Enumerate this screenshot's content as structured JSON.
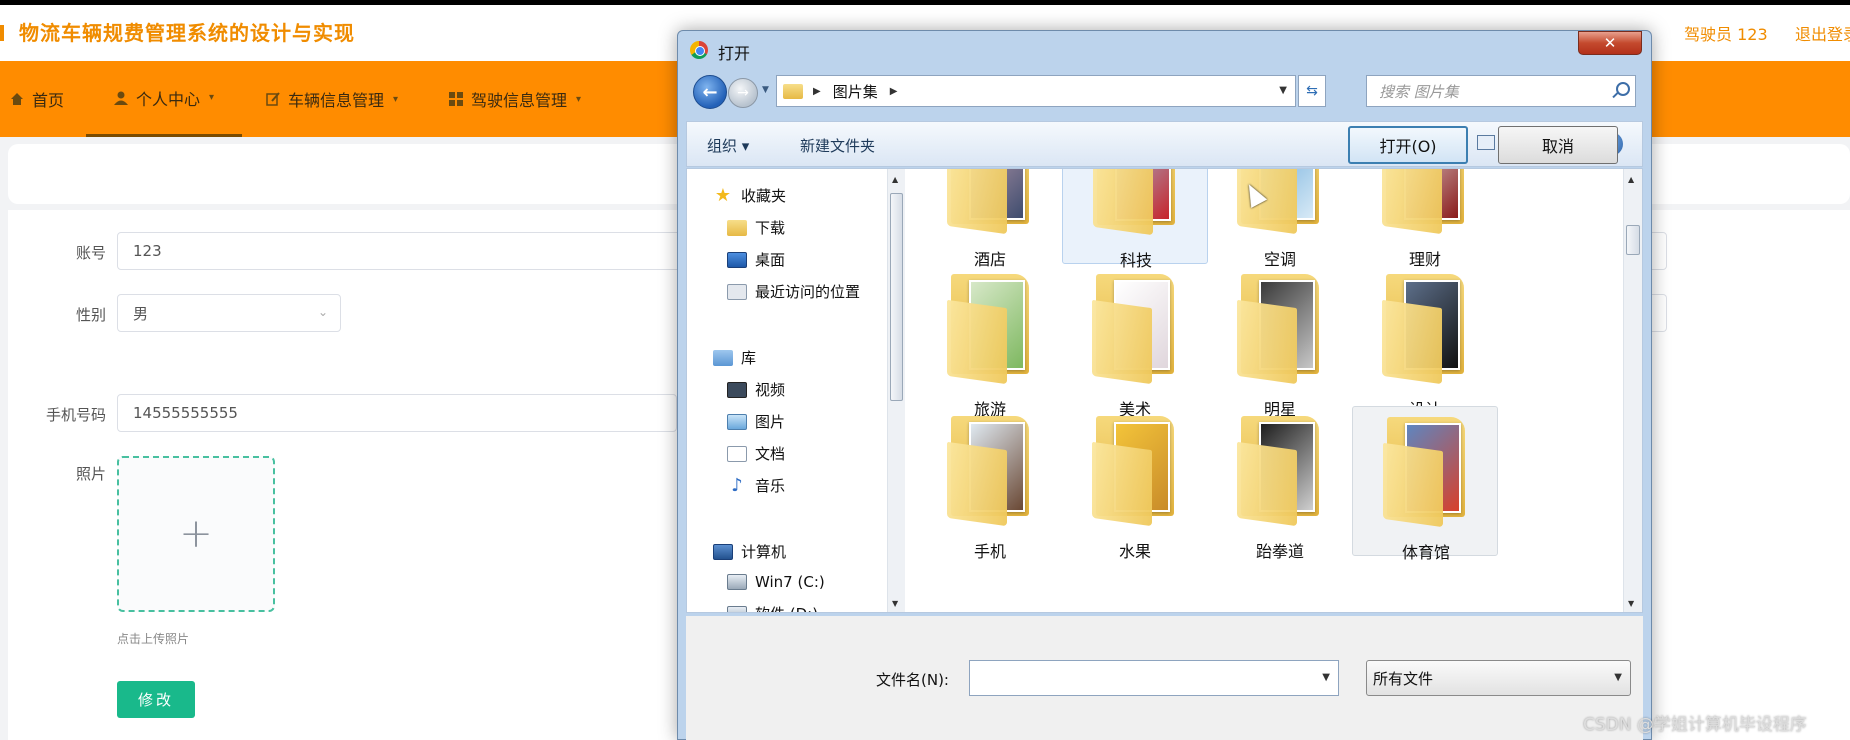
{
  "app": {
    "title": "物流车辆规费管理系统的设计与实现",
    "user_label": "驾驶员 123",
    "logout_label": "退出登录",
    "accent_color": "#ff8c00"
  },
  "nav": {
    "items": [
      {
        "label": "首页",
        "icon": "home-icon"
      },
      {
        "label": "个人中心",
        "icon": "user-icon"
      },
      {
        "label": "车辆信息管理",
        "icon": "edit-icon"
      },
      {
        "label": "驾驶信息管理",
        "icon": "grid-icon"
      }
    ],
    "active_index": 1
  },
  "form": {
    "account_label": "账号",
    "account_value": "123",
    "gender_label": "性别",
    "gender_value": "男",
    "phone_label": "手机号码",
    "phone_value": "14555555555",
    "photo_label": "照片",
    "upload_plus": "+",
    "upload_hint": "点击上传照片",
    "submit_label": "修改"
  },
  "dialog": {
    "title": "打开",
    "close_label": "✕",
    "path": "图片集",
    "search_placeholder": "搜索 图片集",
    "toolbar": {
      "organize_label": "组织 ▾",
      "new_folder_label": "新建文件夹"
    },
    "tree": [
      {
        "label": "收藏夹",
        "icon": "star-icon"
      },
      {
        "label": "下载",
        "icon": "download-folder-icon"
      },
      {
        "label": "桌面",
        "icon": "desktop-icon"
      },
      {
        "label": "最近访问的位置",
        "icon": "recent-places-icon"
      },
      {
        "label": "库",
        "icon": "library-icon"
      },
      {
        "label": "视频",
        "icon": "video-icon"
      },
      {
        "label": "图片",
        "icon": "pictures-icon"
      },
      {
        "label": "文档",
        "icon": "documents-icon"
      },
      {
        "label": "音乐",
        "icon": "music-icon"
      },
      {
        "label": "计算机",
        "icon": "computer-icon"
      },
      {
        "label": "Win7 (C:)",
        "icon": "drive-icon"
      },
      {
        "label": "软件 (D:)",
        "icon": "drive-icon"
      }
    ],
    "folders": [
      {
        "label": "酒店",
        "colors": [
          "#c7a4b4",
          "#3e4c6e"
        ]
      },
      {
        "label": "科技",
        "colors": [
          "#9cc6e6",
          "#c7242a"
        ]
      },
      {
        "label": "空调",
        "colors": [
          "#5ea3d8",
          "#d8eaf6"
        ]
      },
      {
        "label": "理财",
        "colors": [
          "#e3e3e3",
          "#8a1a1a"
        ]
      },
      {
        "label": "旅游",
        "colors": [
          "#d7e8c8",
          "#7eb860"
        ]
      },
      {
        "label": "美术",
        "colors": [
          "#ffffff",
          "#e0d6dc"
        ]
      },
      {
        "label": "明星",
        "colors": [
          "#3a3a3a",
          "#c7c7c7"
        ]
      },
      {
        "label": "设计",
        "colors": [
          "#5d6f8a",
          "#111111"
        ]
      },
      {
        "label": "手机",
        "colors": [
          "#dfe9f1",
          "#6a4834"
        ]
      },
      {
        "label": "水果",
        "colors": [
          "#f3c43a",
          "#c98c2a"
        ]
      },
      {
        "label": "跆拳道",
        "colors": [
          "#1e1e1e",
          "#cfcfcf"
        ]
      },
      {
        "label": "体育馆",
        "colors": [
          "#5e86c0",
          "#d8402a"
        ]
      }
    ],
    "selected_folder": "科技",
    "hover_folder": "体育馆",
    "filename_label": "文件名(N):",
    "filename_value": "",
    "filetype_value": "所有文件",
    "open_label": "打开(O)",
    "cancel_label": "取消"
  },
  "watermark": "CSDN @学姐计算机毕设程序"
}
